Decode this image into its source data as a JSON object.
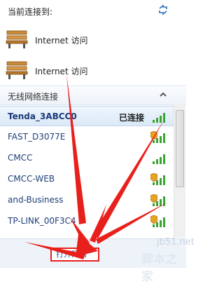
{
  "header": {
    "title": "当前连接到:",
    "refresh_icon": "refresh-arrows-icon"
  },
  "connections": [
    {
      "icon": "bench-network-icon",
      "label": "Internet 访问"
    },
    {
      "icon": "bench-network-icon",
      "label": "Internet 访问"
    }
  ],
  "section": {
    "title": "无线网络连接",
    "collapse_icon": "chevron-up-icon"
  },
  "networks": [
    {
      "name": "Tenda_3ABCC0",
      "status": "已连接",
      "secured": false,
      "selected": true
    },
    {
      "name": "FAST_D3077E",
      "status": "",
      "secured": true,
      "selected": false
    },
    {
      "name": "CMCC",
      "status": "",
      "secured": false,
      "selected": false
    },
    {
      "name": "CMCC-WEB",
      "status": "",
      "secured": true,
      "selected": false
    },
    {
      "name": "and-Business",
      "status": "",
      "secured": true,
      "selected": false
    },
    {
      "name": "TP-LINK_00F3C4",
      "status": "",
      "secured": true,
      "selected": false
    }
  ],
  "footer": {
    "link_label": "打开网络"
  },
  "watermark": {
    "site": "jb51.net",
    "brand": "脚本之家"
  },
  "colors": {
    "annotation_red": "#e8201c",
    "signal_green": "#3aa431",
    "shield_orange": "#e8a321"
  }
}
